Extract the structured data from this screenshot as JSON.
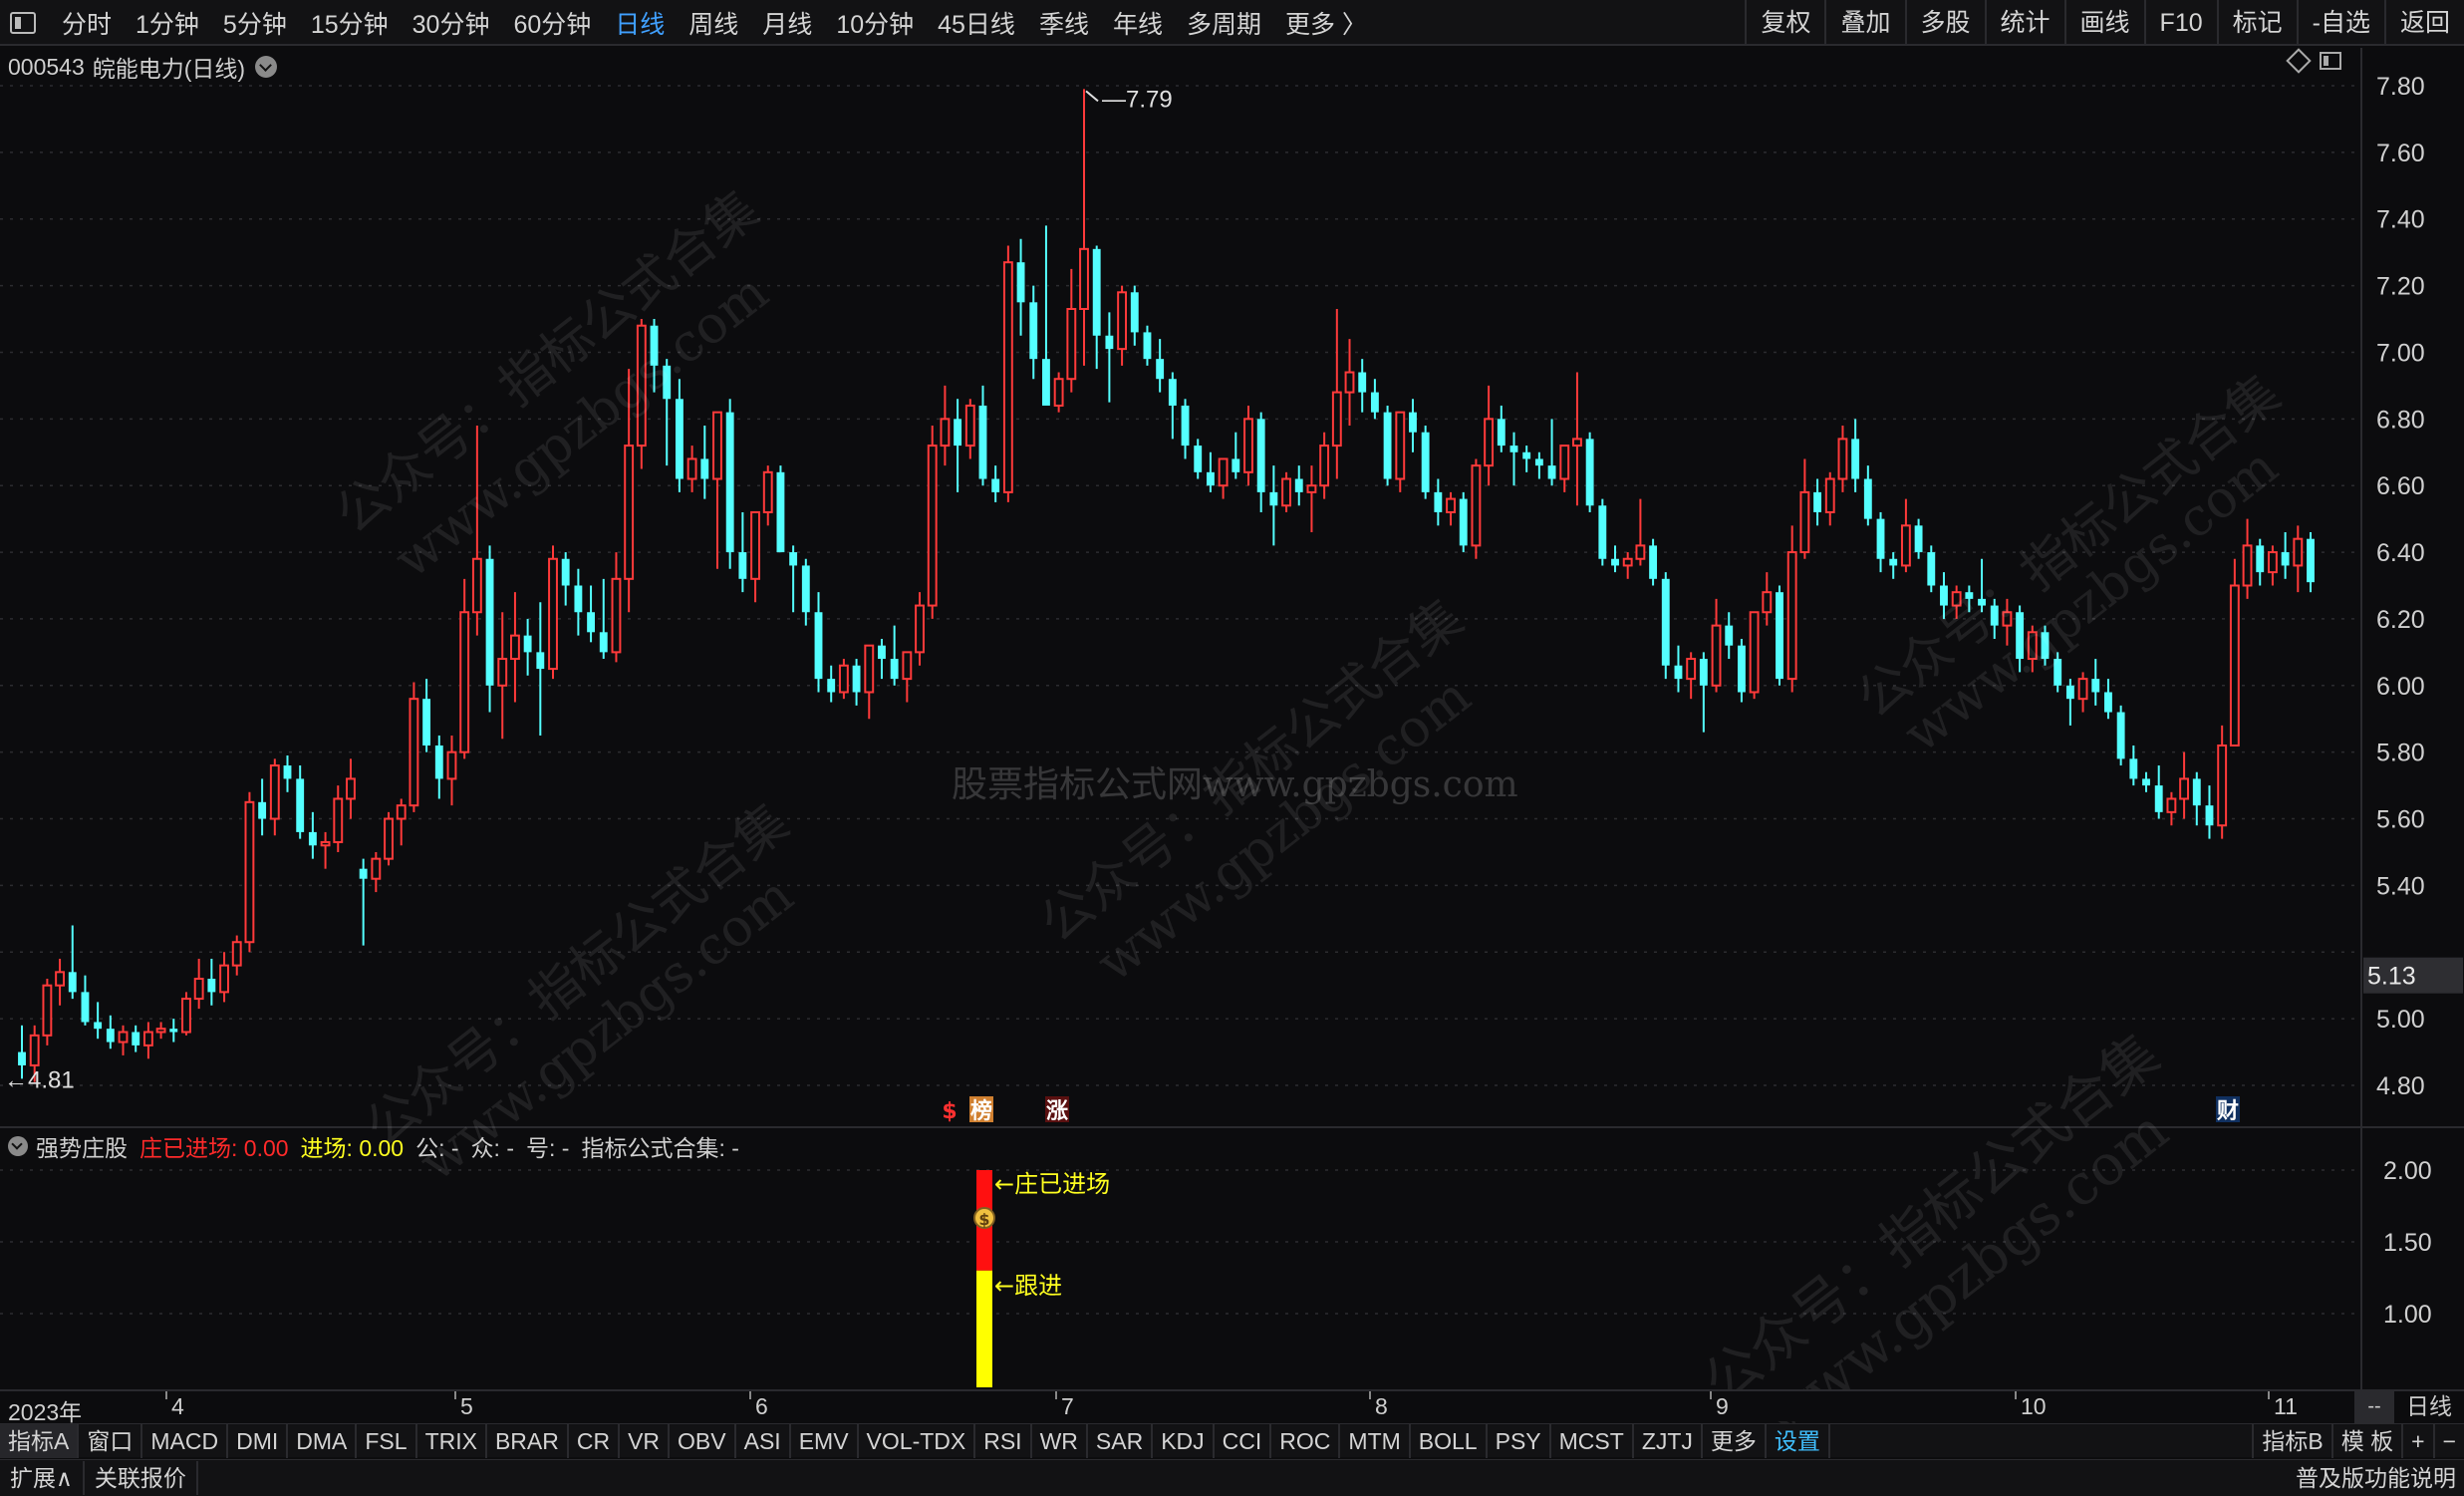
{
  "toolbar": {
    "periods": [
      "分时",
      "1分钟",
      "5分钟",
      "15分钟",
      "30分钟",
      "60分钟",
      "日线",
      "周线",
      "月线",
      "10分钟",
      "45日线",
      "季线",
      "年线",
      "多周期",
      "更多 〉"
    ],
    "active_period": "日线",
    "right_buttons": [
      "复权",
      "叠加",
      "多股",
      "统计",
      "画线",
      "F10",
      "标记",
      "-自选",
      "返回"
    ]
  },
  "stock": {
    "code": "000543",
    "name": "皖能电力",
    "period": "(日线)"
  },
  "price_labels": {
    "high": "7.79",
    "low": "4.81",
    "current": "5.13"
  },
  "markers": {
    "dollar": "$",
    "bang": "榜",
    "zhang": "涨",
    "cai": "财"
  },
  "watermarks": {
    "center": "股票指标公式网www.gpzbgs.com",
    "gzh": "公众号：指标公式合集",
    "site": "www.gpzbgs.com"
  },
  "indicator": {
    "name": "强势庄股",
    "zhuang_label": "庄已进场: 0.00",
    "jinchang_label": "进场: 0.00",
    "gong": "公: -",
    "zhong": "众: -",
    "hao": "号: -",
    "heji": "指标公式合集: -",
    "annotation_top": "←庄已进场",
    "annotation_bottom": "←跟进"
  },
  "date_axis": {
    "labels": [
      "2023年",
      "4",
      "5",
      "6",
      "7",
      "8",
      "9",
      "10",
      "11"
    ],
    "dash": "--",
    "right_label": "日线"
  },
  "bottom_tabs": [
    "指标A",
    "窗口",
    "MACD",
    "DMI",
    "DMA",
    "FSL",
    "TRIX",
    "BRAR",
    "CR",
    "VR",
    "OBV",
    "ASI",
    "EMV",
    "VOL-TDX",
    "RSI",
    "WR",
    "SAR",
    "KDJ",
    "CCI",
    "ROC",
    "MTM",
    "BOLL",
    "PSY",
    "MCST",
    "ZJTJ",
    "更多",
    "设置"
  ],
  "bottom_tabs_active": "设置",
  "bottom_right_tabs": [
    "指标B",
    "模 板",
    "+",
    "−"
  ],
  "status_bar": {
    "expand": "扩展∧",
    "linked": "关联报价",
    "right": "普及版功能说明"
  },
  "colors": {
    "up": "#ff3a3a",
    "down": "#54ffff",
    "background": "#0c0c0e",
    "active_tab": "#40a0ff",
    "signal_red": "#ff1010",
    "signal_yellow": "#ffff00"
  },
  "chart_data": {
    "type": "candlestick",
    "y_main": {
      "ticks": [
        7.8,
        7.6,
        7.4,
        7.2,
        7.0,
        6.8,
        6.6,
        6.4,
        6.2,
        6.0,
        5.8,
        5.6,
        5.4,
        5.2,
        5.0,
        4.8
      ],
      "tick_labels_shown": [
        "7.80",
        "7.60",
        "7.40",
        "7.20",
        "7.00",
        "6.80",
        "6.60",
        "6.40",
        "6.20",
        "6.00",
        "5.80",
        "5.60",
        "5.40",
        "5.00",
        "4.80"
      ]
    },
    "y_indicator": {
      "ticks": [
        "2.00",
        "1.50",
        "1.00"
      ],
      "values": [
        2.0,
        1.5,
        1.0
      ]
    },
    "candles": [
      [
        4.9,
        4.98,
        4.82,
        4.86
      ],
      [
        4.86,
        4.98,
        4.81,
        4.95
      ],
      [
        4.95,
        5.12,
        4.92,
        5.1
      ],
      [
        5.1,
        5.18,
        5.04,
        5.14
      ],
      [
        5.14,
        5.28,
        5.06,
        5.08
      ],
      [
        5.08,
        5.13,
        4.98,
        4.99
      ],
      [
        4.99,
        5.05,
        4.94,
        4.97
      ],
      [
        4.97,
        5.01,
        4.91,
        4.93
      ],
      [
        4.93,
        4.98,
        4.89,
        4.96
      ],
      [
        4.96,
        4.98,
        4.9,
        4.92
      ],
      [
        4.92,
        4.99,
        4.88,
        4.96
      ],
      [
        4.96,
        4.99,
        4.94,
        4.97
      ],
      [
        4.97,
        5.0,
        4.93,
        4.96
      ],
      [
        4.96,
        5.08,
        4.95,
        5.06
      ],
      [
        5.06,
        5.18,
        5.03,
        5.12
      ],
      [
        5.12,
        5.18,
        5.04,
        5.08
      ],
      [
        5.08,
        5.2,
        5.05,
        5.16
      ],
      [
        5.16,
        5.25,
        5.13,
        5.23
      ],
      [
        5.23,
        5.68,
        5.2,
        5.65
      ],
      [
        5.65,
        5.72,
        5.55,
        5.6
      ],
      [
        5.6,
        5.78,
        5.55,
        5.76
      ],
      [
        5.76,
        5.79,
        5.68,
        5.72
      ],
      [
        5.72,
        5.76,
        5.54,
        5.56
      ],
      [
        5.56,
        5.62,
        5.48,
        5.52
      ],
      [
        5.52,
        5.56,
        5.45,
        5.53
      ],
      [
        5.53,
        5.7,
        5.5,
        5.66
      ],
      [
        5.66,
        5.78,
        5.6,
        5.72
      ],
      [
        5.45,
        5.48,
        5.22,
        5.42
      ],
      [
        5.42,
        5.5,
        5.38,
        5.48
      ],
      [
        5.48,
        5.62,
        5.46,
        5.6
      ],
      [
        5.6,
        5.66,
        5.52,
        5.64
      ],
      [
        5.64,
        6.01,
        5.62,
        5.96
      ],
      [
        5.96,
        6.02,
        5.8,
        5.82
      ],
      [
        5.82,
        5.85,
        5.66,
        5.72
      ],
      [
        5.72,
        5.85,
        5.64,
        5.8
      ],
      [
        5.8,
        6.32,
        5.78,
        6.22
      ],
      [
        6.22,
        6.78,
        6.15,
        6.38
      ],
      [
        6.38,
        6.42,
        5.92,
        6.0
      ],
      [
        6.0,
        6.22,
        5.84,
        6.08
      ],
      [
        6.08,
        6.28,
        5.95,
        6.15
      ],
      [
        6.15,
        6.2,
        6.03,
        6.1
      ],
      [
        6.1,
        6.25,
        5.85,
        6.05
      ],
      [
        6.05,
        6.42,
        6.02,
        6.38
      ],
      [
        6.38,
        6.4,
        6.24,
        6.3
      ],
      [
        6.3,
        6.35,
        6.15,
        6.22
      ],
      [
        6.22,
        6.3,
        6.13,
        6.16
      ],
      [
        6.16,
        6.32,
        6.08,
        6.1
      ],
      [
        6.1,
        6.4,
        6.07,
        6.32
      ],
      [
        6.32,
        6.95,
        6.22,
        6.72
      ],
      [
        6.72,
        7.1,
        6.65,
        7.08
      ],
      [
        7.08,
        7.1,
        6.88,
        6.96
      ],
      [
        6.96,
        6.98,
        6.66,
        6.86
      ],
      [
        6.86,
        6.92,
        6.58,
        6.62
      ],
      [
        6.62,
        6.72,
        6.58,
        6.68
      ],
      [
        6.68,
        6.78,
        6.56,
        6.62
      ],
      [
        6.62,
        6.8,
        6.35,
        6.82
      ],
      [
        6.82,
        6.86,
        6.35,
        6.4
      ],
      [
        6.4,
        6.52,
        6.28,
        6.32
      ],
      [
        6.32,
        6.5,
        6.25,
        6.52
      ],
      [
        6.52,
        6.66,
        6.48,
        6.64
      ],
      [
        6.64,
        6.66,
        6.4,
        6.4
      ],
      [
        6.4,
        6.42,
        6.22,
        6.36
      ],
      [
        6.36,
        6.38,
        6.18,
        6.22
      ],
      [
        6.22,
        6.28,
        5.98,
        6.02
      ],
      [
        6.02,
        6.06,
        5.95,
        5.98
      ],
      [
        5.98,
        6.08,
        5.96,
        6.06
      ],
      [
        6.06,
        6.08,
        5.94,
        5.98
      ],
      [
        5.98,
        6.12,
        5.9,
        6.12
      ],
      [
        6.12,
        6.14,
        6.02,
        6.08
      ],
      [
        6.08,
        6.18,
        6.0,
        6.02
      ],
      [
        6.02,
        6.04,
        5.95,
        6.1
      ],
      [
        6.1,
        6.28,
        6.06,
        6.24
      ],
      [
        6.24,
        6.78,
        6.2,
        6.72
      ],
      [
        6.72,
        6.9,
        6.66,
        6.8
      ],
      [
        6.8,
        6.86,
        6.58,
        6.72
      ],
      [
        6.72,
        6.86,
        6.68,
        6.84
      ],
      [
        6.84,
        6.9,
        6.6,
        6.62
      ],
      [
        6.62,
        6.66,
        6.55,
        6.58
      ],
      [
        6.58,
        7.32,
        6.55,
        7.27
      ],
      [
        7.27,
        7.34,
        7.05,
        7.15
      ],
      [
        7.15,
        7.2,
        6.92,
        6.98
      ],
      [
        6.98,
        7.38,
        6.85,
        6.84
      ],
      [
        6.84,
        6.94,
        6.82,
        6.92
      ],
      [
        6.92,
        7.25,
        6.88,
        7.13
      ],
      [
        7.13,
        7.79,
        6.96,
        7.31
      ],
      [
        7.31,
        7.32,
        6.95,
        7.05
      ],
      [
        7.05,
        7.12,
        6.85,
        7.01
      ],
      [
        7.01,
        7.2,
        6.96,
        7.18
      ],
      [
        7.18,
        7.2,
        7.02,
        7.06
      ],
      [
        7.06,
        7.08,
        6.96,
        6.98
      ],
      [
        6.98,
        7.04,
        6.88,
        6.92
      ],
      [
        6.92,
        6.94,
        6.74,
        6.84
      ],
      [
        6.84,
        6.86,
        6.68,
        6.72
      ],
      [
        6.72,
        6.74,
        6.62,
        6.64
      ],
      [
        6.64,
        6.7,
        6.58,
        6.6
      ],
      [
        6.6,
        6.68,
        6.56,
        6.68
      ],
      [
        6.68,
        6.76,
        6.62,
        6.64
      ],
      [
        6.64,
        6.84,
        6.6,
        6.8
      ],
      [
        6.8,
        6.82,
        6.52,
        6.58
      ],
      [
        6.58,
        6.66,
        6.42,
        6.54
      ],
      [
        6.54,
        6.64,
        6.52,
        6.62
      ],
      [
        6.62,
        6.66,
        6.54,
        6.58
      ],
      [
        6.58,
        6.66,
        6.46,
        6.6
      ],
      [
        6.6,
        6.76,
        6.56,
        6.72
      ],
      [
        6.72,
        7.13,
        6.62,
        6.88
      ],
      [
        6.88,
        7.04,
        6.78,
        6.94
      ],
      [
        6.94,
        6.98,
        6.82,
        6.88
      ],
      [
        6.88,
        6.92,
        6.8,
        6.82
      ],
      [
        6.82,
        6.84,
        6.6,
        6.62
      ],
      [
        6.62,
        6.68,
        6.58,
        6.82
      ],
      [
        6.82,
        6.86,
        6.7,
        6.76
      ],
      [
        6.76,
        6.78,
        6.56,
        6.58
      ],
      [
        6.58,
        6.62,
        6.48,
        6.52
      ],
      [
        6.52,
        6.58,
        6.48,
        6.56
      ],
      [
        6.56,
        6.58,
        6.4,
        6.42
      ],
      [
        6.42,
        6.68,
        6.38,
        6.66
      ],
      [
        6.66,
        6.9,
        6.6,
        6.8
      ],
      [
        6.8,
        6.84,
        6.7,
        6.72
      ],
      [
        6.72,
        6.76,
        6.6,
        6.7
      ],
      [
        6.7,
        6.72,
        6.64,
        6.68
      ],
      [
        6.68,
        6.7,
        6.62,
        6.66
      ],
      [
        6.66,
        6.8,
        6.6,
        6.62
      ],
      [
        6.62,
        6.66,
        6.58,
        6.72
      ],
      [
        6.72,
        6.94,
        6.54,
        6.74
      ],
      [
        6.74,
        6.76,
        6.52,
        6.54
      ],
      [
        6.54,
        6.56,
        6.36,
        6.38
      ],
      [
        6.38,
        6.42,
        6.34,
        6.36
      ],
      [
        6.36,
        6.4,
        6.32,
        6.38
      ],
      [
        6.38,
        6.56,
        6.36,
        6.42
      ],
      [
        6.42,
        6.44,
        6.3,
        6.32
      ],
      [
        6.32,
        6.34,
        6.02,
        6.06
      ],
      [
        6.06,
        6.12,
        5.98,
        6.02
      ],
      [
        6.02,
        6.1,
        5.96,
        6.08
      ],
      [
        6.08,
        6.1,
        5.86,
        6.0
      ],
      [
        6.0,
        6.26,
        5.98,
        6.18
      ],
      [
        6.18,
        6.22,
        6.08,
        6.12
      ],
      [
        6.12,
        6.14,
        5.95,
        5.98
      ],
      [
        5.98,
        6.06,
        5.96,
        6.22
      ],
      [
        6.22,
        6.34,
        6.18,
        6.28
      ],
      [
        6.28,
        6.3,
        6.0,
        6.02
      ],
      [
        6.02,
        6.48,
        5.98,
        6.4
      ],
      [
        6.4,
        6.68,
        6.38,
        6.58
      ],
      [
        6.58,
        6.62,
        6.48,
        6.52
      ],
      [
        6.52,
        6.64,
        6.48,
        6.62
      ],
      [
        6.62,
        6.78,
        6.58,
        6.74
      ],
      [
        6.74,
        6.8,
        6.58,
        6.62
      ],
      [
        6.62,
        6.66,
        6.48,
        6.5
      ],
      [
        6.5,
        6.52,
        6.34,
        6.38
      ],
      [
        6.38,
        6.4,
        6.32,
        6.36
      ],
      [
        6.36,
        6.56,
        6.34,
        6.48
      ],
      [
        6.48,
        6.5,
        6.38,
        6.4
      ],
      [
        6.4,
        6.42,
        6.28,
        6.3
      ],
      [
        6.3,
        6.34,
        6.2,
        6.24
      ],
      [
        6.24,
        6.3,
        6.2,
        6.28
      ],
      [
        6.28,
        6.3,
        6.22,
        6.26
      ],
      [
        6.26,
        6.38,
        6.22,
        6.24
      ],
      [
        6.24,
        6.26,
        6.14,
        6.18
      ],
      [
        6.18,
        6.26,
        6.12,
        6.22
      ],
      [
        6.22,
        6.24,
        6.04,
        6.08
      ],
      [
        6.08,
        6.18,
        6.04,
        6.16
      ],
      [
        6.16,
        6.18,
        6.06,
        6.08
      ],
      [
        6.08,
        6.1,
        5.98,
        6.0
      ],
      [
        6.0,
        6.02,
        5.88,
        5.96
      ],
      [
        5.96,
        6.04,
        5.92,
        6.02
      ],
      [
        6.02,
        6.08,
        5.94,
        5.98
      ],
      [
        5.98,
        6.02,
        5.9,
        5.92
      ],
      [
        5.92,
        5.94,
        5.76,
        5.78
      ],
      [
        5.78,
        5.82,
        5.7,
        5.72
      ],
      [
        5.72,
        5.74,
        5.68,
        5.7
      ],
      [
        5.7,
        5.76,
        5.6,
        5.62
      ],
      [
        5.62,
        5.68,
        5.58,
        5.66
      ],
      [
        5.66,
        5.8,
        5.6,
        5.72
      ],
      [
        5.72,
        5.74,
        5.58,
        5.64
      ],
      [
        5.64,
        5.7,
        5.54,
        5.58
      ],
      [
        5.58,
        5.88,
        5.54,
        5.82
      ],
      [
        5.82,
        6.38,
        5.98,
        6.3
      ],
      [
        6.3,
        6.5,
        6.26,
        6.42
      ],
      [
        6.42,
        6.44,
        6.3,
        6.34
      ],
      [
        6.34,
        6.42,
        6.3,
        6.4
      ],
      [
        6.4,
        6.46,
        6.32,
        6.36
      ],
      [
        6.36,
        6.48,
        6.28,
        6.44
      ],
      [
        6.44,
        6.46,
        6.28,
        6.31
      ]
    ],
    "signal_bars": {
      "zhuang_range": [
        1.3,
        2.0
      ],
      "gen_range": [
        0.0,
        1.3
      ]
    }
  }
}
